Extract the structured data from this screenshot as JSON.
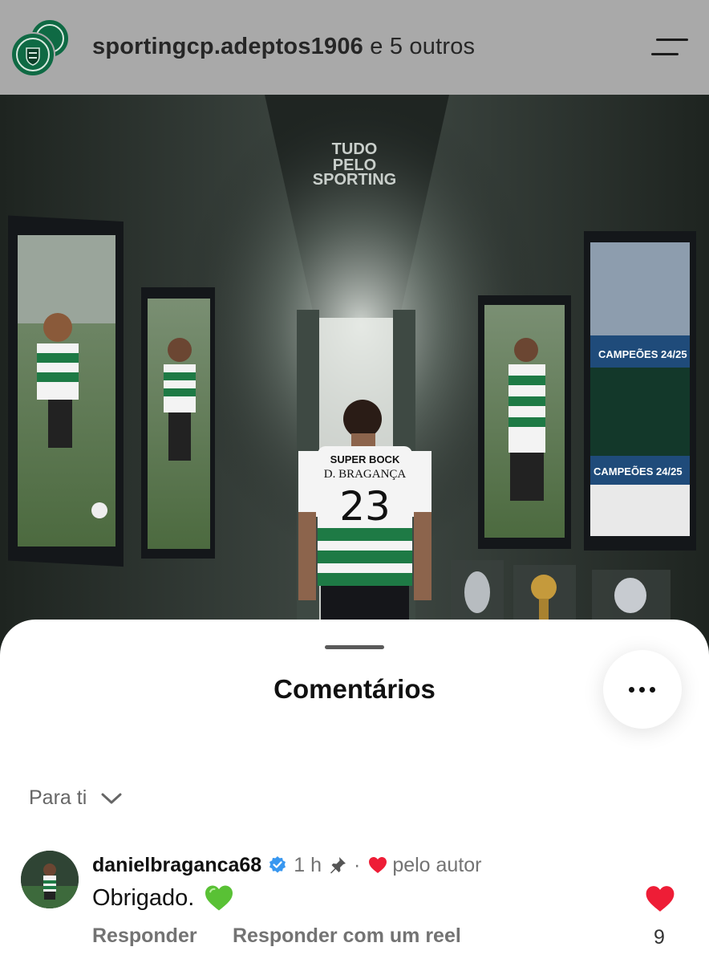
{
  "header": {
    "account": "sportingcp.adeptos1906",
    "others": "e 5 outros",
    "avatar_icon": "club-crest-icon",
    "menu_icon": "menu-icon"
  },
  "post": {
    "image_icon": "post-image",
    "watermark": [
      "TUDO",
      "PELO",
      "SPORTING"
    ],
    "jersey": {
      "sponsor": "SUPER BOCK",
      "name": "D. BRAGANÇA",
      "number": "23"
    },
    "champions_banner": [
      "CAMPEÕES 24/25",
      "CAMPEÕES 24/25"
    ]
  },
  "comments_sheet": {
    "title": "Comentários",
    "more_icon": "more-horizontal-icon",
    "filter": {
      "label": "Para ti",
      "icon": "chevron-down-icon"
    },
    "comments": [
      {
        "username": "danielbraganca68",
        "verified": true,
        "time": "1 h",
        "pinned": true,
        "separator": "·",
        "liked_by_author_label": "pelo autor",
        "text": "Obrigado.",
        "emoji": "green-heart",
        "reply_label": "Responder",
        "reply_reel_label": "Responder com um reel",
        "likes": "9",
        "liked": true
      }
    ]
  },
  "colors": {
    "header_bg": "#a9a9a9",
    "like_red": "#ee1d36",
    "verified_blue": "#3897f0",
    "green_heart": "#59c135",
    "muted_text": "#737373"
  }
}
